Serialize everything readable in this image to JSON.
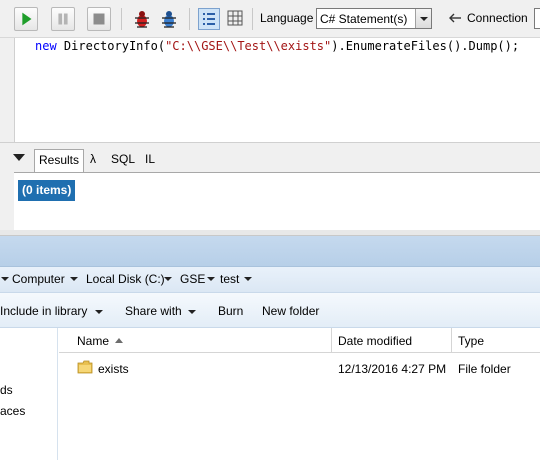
{
  "toolbar": {
    "language_label": "Language",
    "language_value": "C# Statement(s)",
    "connection_label": "Connection"
  },
  "editor": {
    "code_prefix": "new DirectoryInfo(",
    "code_string": "\"C:\\\\GSE\\\\Test\\\\exists\"",
    "code_suffix": ").EnumerateFiles().Dump();"
  },
  "results": {
    "tabs": [
      "Results",
      "λ",
      "SQL",
      "IL"
    ],
    "items_badge": "(0 items)"
  },
  "explorer": {
    "breadcrumb": [
      "Computer",
      "Local Disk (C:)",
      "GSE",
      "test"
    ],
    "commands": {
      "include_in_library": "Include in library",
      "share_with": "Share with",
      "burn": "Burn",
      "new_folder": "New folder"
    },
    "nav_items": [
      "ds",
      "aces"
    ],
    "columns": {
      "name": "Name",
      "date_modified": "Date modified",
      "type": "Type"
    },
    "rows": [
      {
        "name": "exists",
        "date_modified": "12/13/2016 4:27 PM",
        "type": "File folder"
      }
    ]
  },
  "colors": {
    "badge_bg": "#1f6fb0",
    "keyword": "#0000ff",
    "string": "#a31515",
    "run_green": "#1f9e2a"
  },
  "icons": [
    "run-icon",
    "pause-icon",
    "stop-icon",
    "bug-icon",
    "debug-bug-icon",
    "rich-text-grid-icon",
    "data-grid-icon",
    "connection-arrow-icon",
    "folder-icon"
  ]
}
